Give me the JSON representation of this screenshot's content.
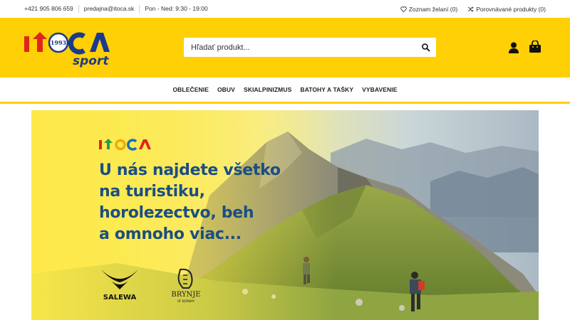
{
  "topbar": {
    "phone": "+421 905 806 659",
    "email": "predajna@itoca.sk",
    "hours": "Pon - Ned: 9:30 - 19:00",
    "wishlist_label": "Zoznam želaní (0)",
    "compare_label": "Porovnávané produkty (0)"
  },
  "header": {
    "logo_text_main": "ITOCA",
    "logo_text_year": "1993",
    "logo_text_sport": "sport",
    "search_placeholder": "Hľadať produkt..."
  },
  "nav": {
    "items": [
      "OBLEČENIE",
      "OBUV",
      "SKIALPINIZMUS",
      "BATOHY A TAŠKY",
      "VYBAVENIE"
    ]
  },
  "hero": {
    "logo_text": "ITOCA",
    "headline_lines": [
      "U nás najdete všetko",
      "na turistiku,",
      "horolezectvo, beh",
      "a omnoho viac..."
    ],
    "brands": [
      "SALEWA",
      "BRYNJE",
      "OF NORWAY"
    ]
  },
  "colors": {
    "brand_yellow": "#ffd006",
    "headline_blue": "#1a4e84",
    "logo_red": "#e1251b",
    "logo_navy": "#1b3a8c"
  }
}
